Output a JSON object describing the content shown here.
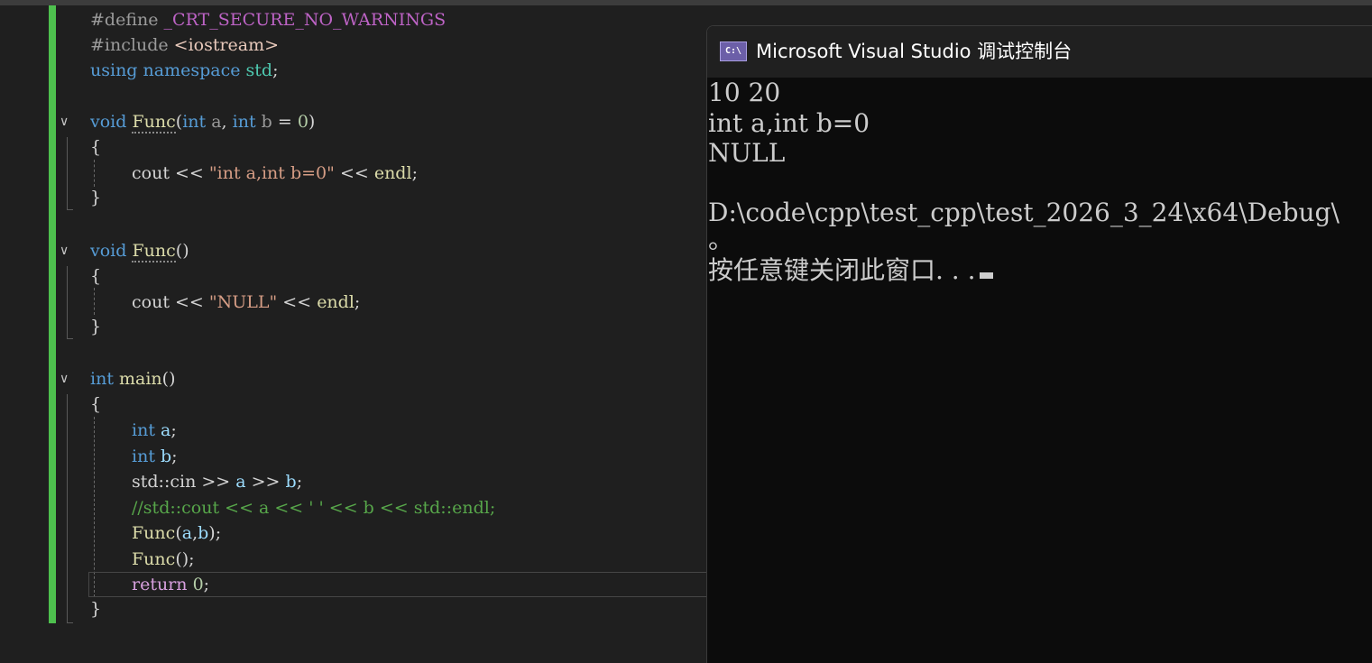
{
  "editor": {
    "line1": {
      "directive": "#define",
      "macro": "_CRT_SECURE_NO_WARNINGS"
    },
    "line2": {
      "directive": "#include",
      "header": "<iostream>"
    },
    "line3": {
      "using": "using",
      "namespace": "namespace",
      "name": "std",
      "semi": ";"
    },
    "line5": {
      "type": "void",
      "name": "Func",
      "open": "(",
      "type_a": "int",
      "param_a": "a",
      "comma": ",",
      "type_b": "int",
      "param_b": "b",
      "eq": "=",
      "default": "0",
      "close": ")"
    },
    "line6": {
      "brace": "{"
    },
    "line7": {
      "cout": "cout",
      "op1": "<<",
      "string": "\"int a,int b=0\"",
      "op2": "<<",
      "endl": "endl",
      "semi": ";"
    },
    "line8": {
      "brace": "}"
    },
    "line10": {
      "type": "void",
      "name": "Func",
      "parens": "()"
    },
    "line11": {
      "brace": "{"
    },
    "line12": {
      "cout": "cout",
      "op1": "<<",
      "string": "\"NULL\"",
      "op2": "<<",
      "endl": "endl",
      "semi": ";"
    },
    "line13": {
      "brace": "}"
    },
    "line15": {
      "type": "int",
      "name": "main",
      "parens": "()"
    },
    "line16": {
      "brace": "{"
    },
    "line17": {
      "type": "int",
      "var": "a",
      "semi": ";"
    },
    "line18": {
      "type": "int",
      "var": "b",
      "semi": ";"
    },
    "line19": {
      "text": "std::cin",
      "op1": ">>",
      "a": "a",
      "op2": ">>",
      "b": "b",
      "semi": ";"
    },
    "line20": {
      "comment": "//std::cout << a << ' ' << b << std::endl;"
    },
    "line21": {
      "name": "Func",
      "open": "(",
      "a": "a",
      "comma": ",",
      "b": "b",
      "close": ")",
      "semi": ";"
    },
    "line22": {
      "name": "Func",
      "parens": "()",
      "semi": ";"
    },
    "line23": {
      "kw": "return",
      "value": "0",
      "semi": ";"
    },
    "line24": {
      "brace": "}"
    },
    "fold_glyph": "∨"
  },
  "console": {
    "icon_text": "C:\\",
    "title": "Microsoft Visual Studio 调试控制台",
    "output": [
      "10 20",
      "int a,int b=0",
      "NULL",
      "",
      "D:\\code\\cpp\\test_cpp\\test_2026_3_24\\x64\\Debug\\",
      "。",
      "按任意键关闭此窗口. . ."
    ]
  }
}
